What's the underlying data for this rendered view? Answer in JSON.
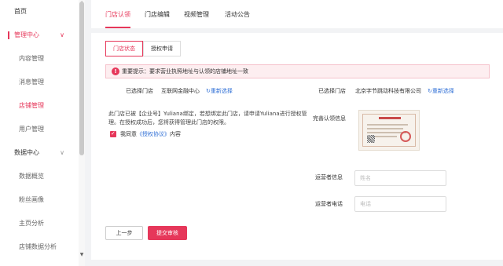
{
  "sidebar": {
    "items": [
      {
        "label": "首页"
      },
      {
        "label": "管理中心"
      },
      {
        "label": "内容管理"
      },
      {
        "label": "消息管理"
      },
      {
        "label": "店铺管理"
      },
      {
        "label": "用户管理"
      },
      {
        "label": "数据中心"
      },
      {
        "label": "数据概览"
      },
      {
        "label": "粉丝画像"
      },
      {
        "label": "主页分析"
      },
      {
        "label": "店铺数据分析"
      }
    ]
  },
  "tabs": [
    "门店认领",
    "门店编辑",
    "视频管理",
    "活动公告"
  ],
  "segments": [
    "门店状态",
    "授权申请"
  ],
  "alert": {
    "text": "重要提示：要求营业执照地址与认领的店铺地址一致"
  },
  "left_store": {
    "label": "已选择门店",
    "value": "互联网金融中心",
    "reselect": "重新选择"
  },
  "right_store": {
    "label": "已选择门店",
    "value": "北京字节跳动科技有限公司",
    "reselect": "重新选择"
  },
  "description": "此门店已被【企业号】Yuliana绑定，若想绑定此门店，请申请Yuliana进行授权管理。在授权成功后，您将获得管理此门店的权限。",
  "agreement": {
    "prefix": "我同意",
    "protocol": "《授权协议》",
    "suffix": "内容"
  },
  "fields": {
    "auth_label": "完善认领信息",
    "operator_info": {
      "label": "运营者信息",
      "placeholder": "姓名"
    },
    "operator_phone": {
      "label": "运营者电话",
      "placeholder": "电话"
    }
  },
  "buttons": {
    "prev": "上一步",
    "submit": "提交审核"
  },
  "colors": {
    "accent": "#e6375a",
    "link": "#2f6fd6"
  }
}
